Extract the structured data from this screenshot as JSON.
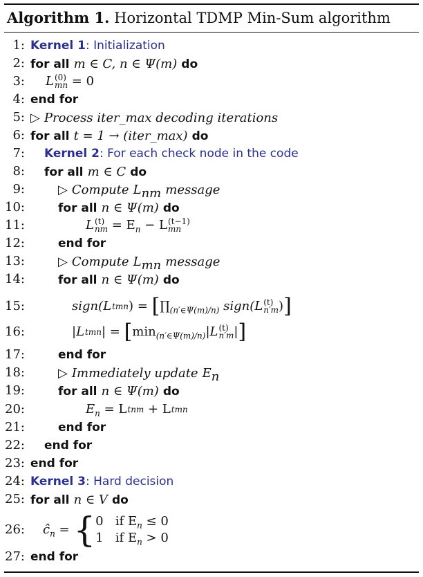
{
  "caption": {
    "label": "Algorithm 1.",
    "title": "Horizontal TDMP Min-Sum algorithm"
  },
  "lines": [
    {
      "n": "1:",
      "kernel": "Kernel 1",
      "rest": ": Initialization"
    },
    {
      "n": "2:",
      "kw": "for all",
      "math": "m ∈ C, n ∈ Ψ(m)",
      "kw2": "do"
    },
    {
      "n": "3:",
      "lhs": "L",
      "sup": "(0)",
      "sub": "mn",
      "rhs": " = 0"
    },
    {
      "n": "4:",
      "kw": "end for"
    },
    {
      "n": "5:",
      "tri": "▷",
      "text": "Process iter_max decoding iterations"
    },
    {
      "n": "6:",
      "kw": "for all",
      "math": "t = 1 → (iter_max)",
      "kw2": "do"
    },
    {
      "n": "7:",
      "kernel": "Kernel 2",
      "rest": ": For each check node in the code"
    },
    {
      "n": "8:",
      "kw": "for all",
      "math": "m ∈ C",
      "kw2": "do"
    },
    {
      "n": "9:",
      "tri": "▷",
      "pre": "Compute",
      "L": "L",
      "Lsub": "nm",
      "post": "message"
    },
    {
      "n": "10:",
      "kw": "for all",
      "math": "n ∈ Ψ(m)",
      "kw2": "do"
    },
    {
      "n": "11:",
      "lhs": "L",
      "sup": "(t)",
      "sub": "nm",
      "mid": " = E",
      "midsub": "n",
      "minus": " − L",
      "sup2": "(t−1)",
      "sub2": "mn"
    },
    {
      "n": "12:",
      "kw": "end for"
    },
    {
      "n": "13:",
      "tri": "▷",
      "pre": "Compute",
      "L": "L",
      "Lsub": "mn",
      "post": "message"
    },
    {
      "n": "14:",
      "kw": "for all",
      "math": "n ∈ Ψ(m)",
      "kw2": "do"
    },
    {
      "n": "15:",
      "fn": "sign(L",
      "sup": "t",
      "sub": "mn",
      "eq": ") = ",
      "prod": "∏",
      "range": "(n′∈Ψ(m)/n)",
      "fn2": " sign(L",
      "sup2": "(t)",
      "sub2": "n′m",
      "close": ")"
    },
    {
      "n": "16:",
      "abs": "|L",
      "sup": "t",
      "sub": "mn",
      "eq": "| = ",
      "min": "min",
      "range": "(n′∈Ψ(m)/n)",
      "abs2": "|L",
      "sup2": "(t)",
      "sub2": "n′m",
      "close": "|"
    },
    {
      "n": "17:",
      "kw": "end for"
    },
    {
      "n": "18:",
      "tri": "▷",
      "pre": "Immediately update",
      "L": "E",
      "Lsub": "n"
    },
    {
      "n": "19:",
      "kw": "for all",
      "math": "n ∈ Ψ(m)",
      "kw2": "do"
    },
    {
      "n": "20:",
      "lhs": "E",
      "lsub": "n",
      "eq": " = L",
      "sup": "t",
      "sub": "nm",
      "plus": " + L",
      "sup2": "t",
      "sub2": "mn"
    },
    {
      "n": "21:",
      "kw": "end for"
    },
    {
      "n": "22:",
      "kw": "end for"
    },
    {
      "n": "23:",
      "kw": "end for"
    },
    {
      "n": "24:",
      "kernel": "Kernel 3",
      "rest": ": Hard decision"
    },
    {
      "n": "25:",
      "kw": "for all",
      "math": "n ∈ V",
      "kw2": "do"
    },
    {
      "n": "26:",
      "lhs": "ĉ",
      "lsub": "n",
      "eq": " = ",
      "case1v": "0",
      "case1c": "if E",
      "case1s": "n",
      "case1r": " ≤ 0",
      "case2v": "1",
      "case2c": "if E",
      "case2s": "n",
      "case2r": " > 0"
    },
    {
      "n": "27:",
      "kw": "end for"
    }
  ]
}
